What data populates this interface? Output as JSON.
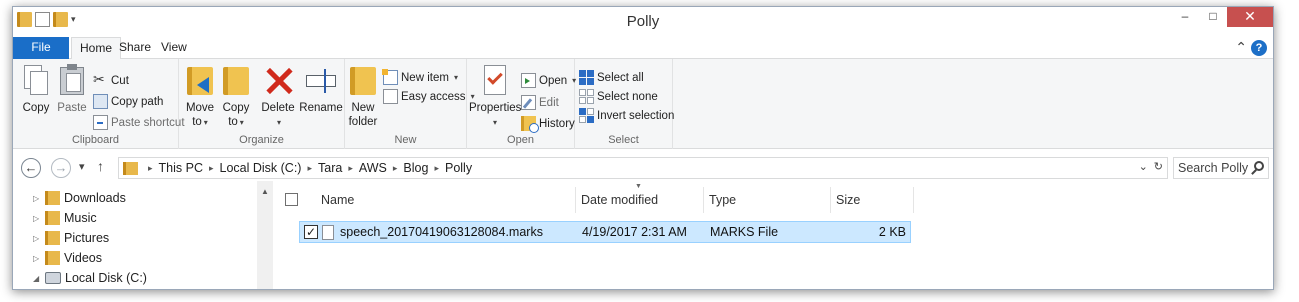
{
  "window": {
    "title": "Polly",
    "controls": {
      "minimize": "–",
      "restore": "□",
      "close": "✕"
    }
  },
  "ribbon_tabs": {
    "file": "File",
    "home": "Home",
    "share": "Share",
    "view": "View"
  },
  "ribbon": {
    "clipboard": {
      "caption": "Clipboard",
      "copy": "Copy",
      "paste": "Paste",
      "cut": "Cut",
      "copy_path": "Copy path",
      "paste_shortcut": "Paste shortcut"
    },
    "organize": {
      "caption": "Organize",
      "move_to_1": "Move",
      "move_to_2": "to",
      "copy_to_1": "Copy",
      "copy_to_2": "to",
      "delete": "Delete",
      "rename": "Rename"
    },
    "new": {
      "caption": "New",
      "new_folder_1": "New",
      "new_folder_2": "folder",
      "new_item": "New item",
      "easy_access": "Easy access"
    },
    "open": {
      "caption": "Open",
      "properties": "Properties",
      "open": "Open",
      "edit": "Edit",
      "history": "History"
    },
    "select": {
      "caption": "Select",
      "select_all": "Select all",
      "select_none": "Select none",
      "invert_selection": "Invert selection"
    }
  },
  "address": {
    "breadcrumbs": [
      "This PC",
      "Local Disk (C:)",
      "Tara",
      "AWS",
      "Blog",
      "Polly"
    ],
    "search_placeholder": "Search Polly"
  },
  "nav_pane": {
    "items": [
      {
        "label": "Downloads"
      },
      {
        "label": "Music"
      },
      {
        "label": "Pictures"
      },
      {
        "label": "Videos"
      },
      {
        "label": "Local Disk (C:)"
      }
    ]
  },
  "file_list": {
    "columns": [
      "Name",
      "Date modified",
      "Type",
      "Size"
    ],
    "rows": [
      {
        "name": "speech_20170419063128084.marks",
        "date_modified": "4/19/2017 2:31 AM",
        "type": "MARKS File",
        "size": "2 KB",
        "selected": true
      }
    ]
  },
  "colors": {
    "file_tab": "#1a6ec8",
    "selection": "#cce8ff",
    "close_button": "#c7504f"
  }
}
